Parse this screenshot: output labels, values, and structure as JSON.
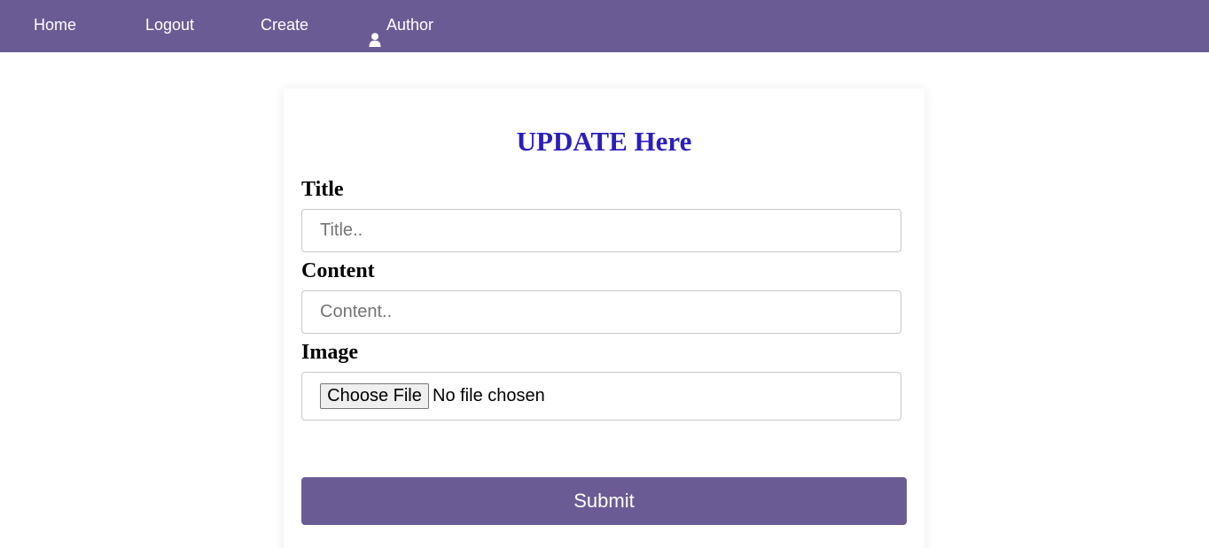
{
  "nav": {
    "home": "Home",
    "logout": "Logout",
    "create": "Create",
    "author": "Author",
    "author_icon": "user-icon",
    "background_color": "#6b5b95"
  },
  "form": {
    "heading": "UPDATE Here",
    "heading_color": "#2b1ebd",
    "title_label": "Title",
    "title_placeholder": "Title..",
    "title_value": "",
    "content_label": "Content",
    "content_placeholder": "Content..",
    "content_value": "",
    "image_label": "Image",
    "file_button_label": "Choose File",
    "file_status": "No file chosen",
    "submit_label": "Submit",
    "submit_color": "#6b5b95"
  }
}
